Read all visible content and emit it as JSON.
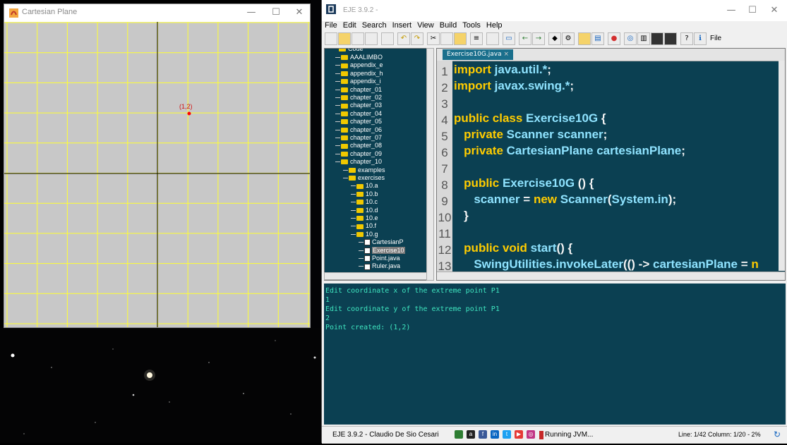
{
  "cartesian_window": {
    "title": "Cartesian Plane",
    "controls": [
      "—",
      "☐",
      "✕"
    ],
    "point_label": "(1,2)"
  },
  "eje_window": {
    "title": "EJE 3.9.2 -",
    "controls": [
      "—",
      "☐",
      "✕"
    ],
    "menu": [
      "File",
      "Edit",
      "Search",
      "Insert",
      "View",
      "Build",
      "Tools",
      "Help"
    ],
    "toolbar_tail_label": "File",
    "tree": {
      "root": "Code",
      "items": [
        {
          "label": "AAALIMBO",
          "kind": "folder",
          "level": 1
        },
        {
          "label": "appendix_e",
          "kind": "folder",
          "level": 1
        },
        {
          "label": "appendix_h",
          "kind": "folder",
          "level": 1
        },
        {
          "label": "appendix_i",
          "kind": "folder",
          "level": 1
        },
        {
          "label": "chapter_01",
          "kind": "folder",
          "level": 1
        },
        {
          "label": "chapter_02",
          "kind": "folder",
          "level": 1
        },
        {
          "label": "chapter_03",
          "kind": "folder",
          "level": 1
        },
        {
          "label": "chapter_04",
          "kind": "folder",
          "level": 1
        },
        {
          "label": "chapter_05",
          "kind": "folder",
          "level": 1
        },
        {
          "label": "chapter_06",
          "kind": "folder",
          "level": 1
        },
        {
          "label": "chapter_07",
          "kind": "folder",
          "level": 1
        },
        {
          "label": "chapter_08",
          "kind": "folder",
          "level": 1
        },
        {
          "label": "chapter_09",
          "kind": "folder",
          "level": 1
        },
        {
          "label": "chapter_10",
          "kind": "folder",
          "level": 1
        },
        {
          "label": "examples",
          "kind": "folder",
          "level": 2
        },
        {
          "label": "exercises",
          "kind": "folder",
          "level": 2
        },
        {
          "label": "10.a",
          "kind": "folder",
          "level": 3
        },
        {
          "label": "10.b",
          "kind": "folder",
          "level": 3
        },
        {
          "label": "10.c",
          "kind": "folder",
          "level": 3
        },
        {
          "label": "10.d",
          "kind": "folder",
          "level": 3
        },
        {
          "label": "10.e",
          "kind": "folder",
          "level": 3
        },
        {
          "label": "10.f",
          "kind": "folder",
          "level": 3
        },
        {
          "label": "10.g",
          "kind": "folder",
          "level": 3
        },
        {
          "label": "CartesianP",
          "kind": "file",
          "level": 4
        },
        {
          "label": "Exercise10",
          "kind": "file",
          "level": 4,
          "selected": true
        },
        {
          "label": "Point.java",
          "kind": "file",
          "level": 4
        },
        {
          "label": "Ruler.java",
          "kind": "file",
          "level": 4
        }
      ]
    },
    "editor": {
      "tab": "Exercise10G.java",
      "lines": [
        {
          "n": "1",
          "parts": [
            [
              "kw",
              "import "
            ],
            [
              "ty",
              "java.util.*"
            ],
            [
              "tx",
              ";"
            ]
          ]
        },
        {
          "n": "2",
          "parts": [
            [
              "kw",
              "import "
            ],
            [
              "ty",
              "javax.swing.*"
            ],
            [
              "tx",
              ";"
            ]
          ]
        },
        {
          "n": "3",
          "parts": []
        },
        {
          "n": "4",
          "parts": [
            [
              "kw",
              "public class "
            ],
            [
              "ty",
              "Exercise10G "
            ],
            [
              "tx",
              "{"
            ]
          ]
        },
        {
          "n": "5",
          "parts": [
            [
              "tx",
              "   "
            ],
            [
              "kw",
              "private "
            ],
            [
              "ty",
              "Scanner scanner"
            ],
            [
              "tx",
              ";"
            ]
          ]
        },
        {
          "n": "6",
          "parts": [
            [
              "tx",
              "   "
            ],
            [
              "kw",
              "private "
            ],
            [
              "ty",
              "CartesianPlane cartesianPlane"
            ],
            [
              "tx",
              ";"
            ]
          ]
        },
        {
          "n": "7",
          "parts": []
        },
        {
          "n": "8",
          "parts": [
            [
              "tx",
              "   "
            ],
            [
              "kw",
              "public "
            ],
            [
              "ty",
              "Exercise10G "
            ],
            [
              "tx",
              "() {"
            ]
          ]
        },
        {
          "n": "9",
          "parts": [
            [
              "tx",
              "      "
            ],
            [
              "ty",
              "scanner "
            ],
            [
              "tx",
              "= "
            ],
            [
              "kw",
              "new "
            ],
            [
              "ty",
              "Scanner"
            ],
            [
              "tx",
              "("
            ],
            [
              "ty",
              "System.in"
            ],
            [
              "tx",
              ");"
            ]
          ]
        },
        {
          "n": "10",
          "parts": [
            [
              "tx",
              "   }"
            ]
          ]
        },
        {
          "n": "11",
          "parts": []
        },
        {
          "n": "12",
          "parts": [
            [
              "tx",
              "   "
            ],
            [
              "kw",
              "public void "
            ],
            [
              "ty",
              "start"
            ],
            [
              "tx",
              "() {"
            ]
          ]
        },
        {
          "n": "13",
          "parts": [
            [
              "tx",
              "      "
            ],
            [
              "ty",
              "SwingUtilities.invokeLater"
            ],
            [
              "tx",
              "(() -> "
            ],
            [
              "ty",
              "cartesianPlane "
            ],
            [
              "tx",
              "= "
            ],
            [
              "kw",
              "n"
            ]
          ]
        }
      ]
    },
    "console": [
      "Edit coordinate x of the extreme point P1",
      "1",
      "Edit coordinate y of the extreme point P1",
      "2",
      "Point created: (1,2)"
    ],
    "status": {
      "app": "EJE 3.9.2 - Claudio De Sio Cesari",
      "running": "Running JVM...",
      "position": "Line: 1/42 Column: 1/20 - 2%"
    },
    "colors": {
      "editor_bg": "#0b4052",
      "keyword": "#ffcc00",
      "identifier": "#8fe3ff",
      "console_text": "#3fe6c0",
      "grid_line": "#ffff33",
      "axis_line": "#000000",
      "point": "#ff0000"
    }
  }
}
